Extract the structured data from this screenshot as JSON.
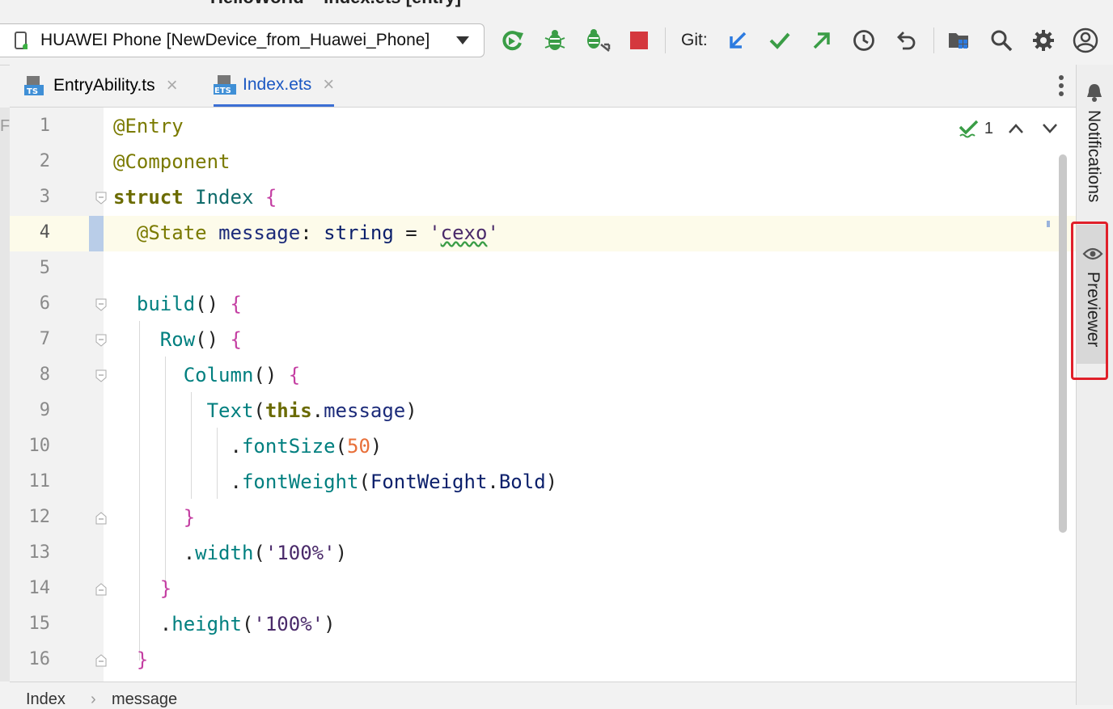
{
  "window": {
    "title": "HelloWorld – Index.ets [entry]"
  },
  "toolbar": {
    "device": "HUAWEI Phone [NewDevice_from_Huawei_Phone]",
    "git_label": "Git:",
    "icons": [
      "rerun-icon",
      "debug-icon",
      "attach-debugger-icon",
      "stop-icon",
      "git-update-icon",
      "git-commit-icon",
      "git-push-icon",
      "history-icon",
      "rollback-icon",
      "project-structure-icon",
      "search-icon",
      "settings-icon",
      "account-icon"
    ]
  },
  "tabs": [
    {
      "label": "EntryAbility.ts",
      "badge": "TS",
      "active": false
    },
    {
      "label": "Index.ets",
      "badge": "ETS",
      "active": true
    }
  ],
  "editor": {
    "inspection_count": "1",
    "lines": [
      {
        "n": "1",
        "text": "@Entry"
      },
      {
        "n": "2",
        "text": "@Component"
      },
      {
        "n": "3",
        "text": "struct Index {"
      },
      {
        "n": "4",
        "text": "  @State message: string = 'cexo'"
      },
      {
        "n": "5",
        "text": ""
      },
      {
        "n": "6",
        "text": "  build() {"
      },
      {
        "n": "7",
        "text": "    Row() {"
      },
      {
        "n": "8",
        "text": "      Column() {"
      },
      {
        "n": "9",
        "text": "        Text(this.message)"
      },
      {
        "n": "10",
        "text": "          .fontSize(50)"
      },
      {
        "n": "11",
        "text": "          .fontWeight(FontWeight.Bold)"
      },
      {
        "n": "12",
        "text": "      }"
      },
      {
        "n": "13",
        "text": "      .width('100%')"
      },
      {
        "n": "14",
        "text": "    }"
      },
      {
        "n": "15",
        "text": "    .height('100%')"
      },
      {
        "n": "16",
        "text": "  }"
      }
    ]
  },
  "breadcrumb": [
    "Index",
    "message"
  ],
  "sidebar": {
    "notifications": "Notifications",
    "previewer": "Previewer"
  }
}
